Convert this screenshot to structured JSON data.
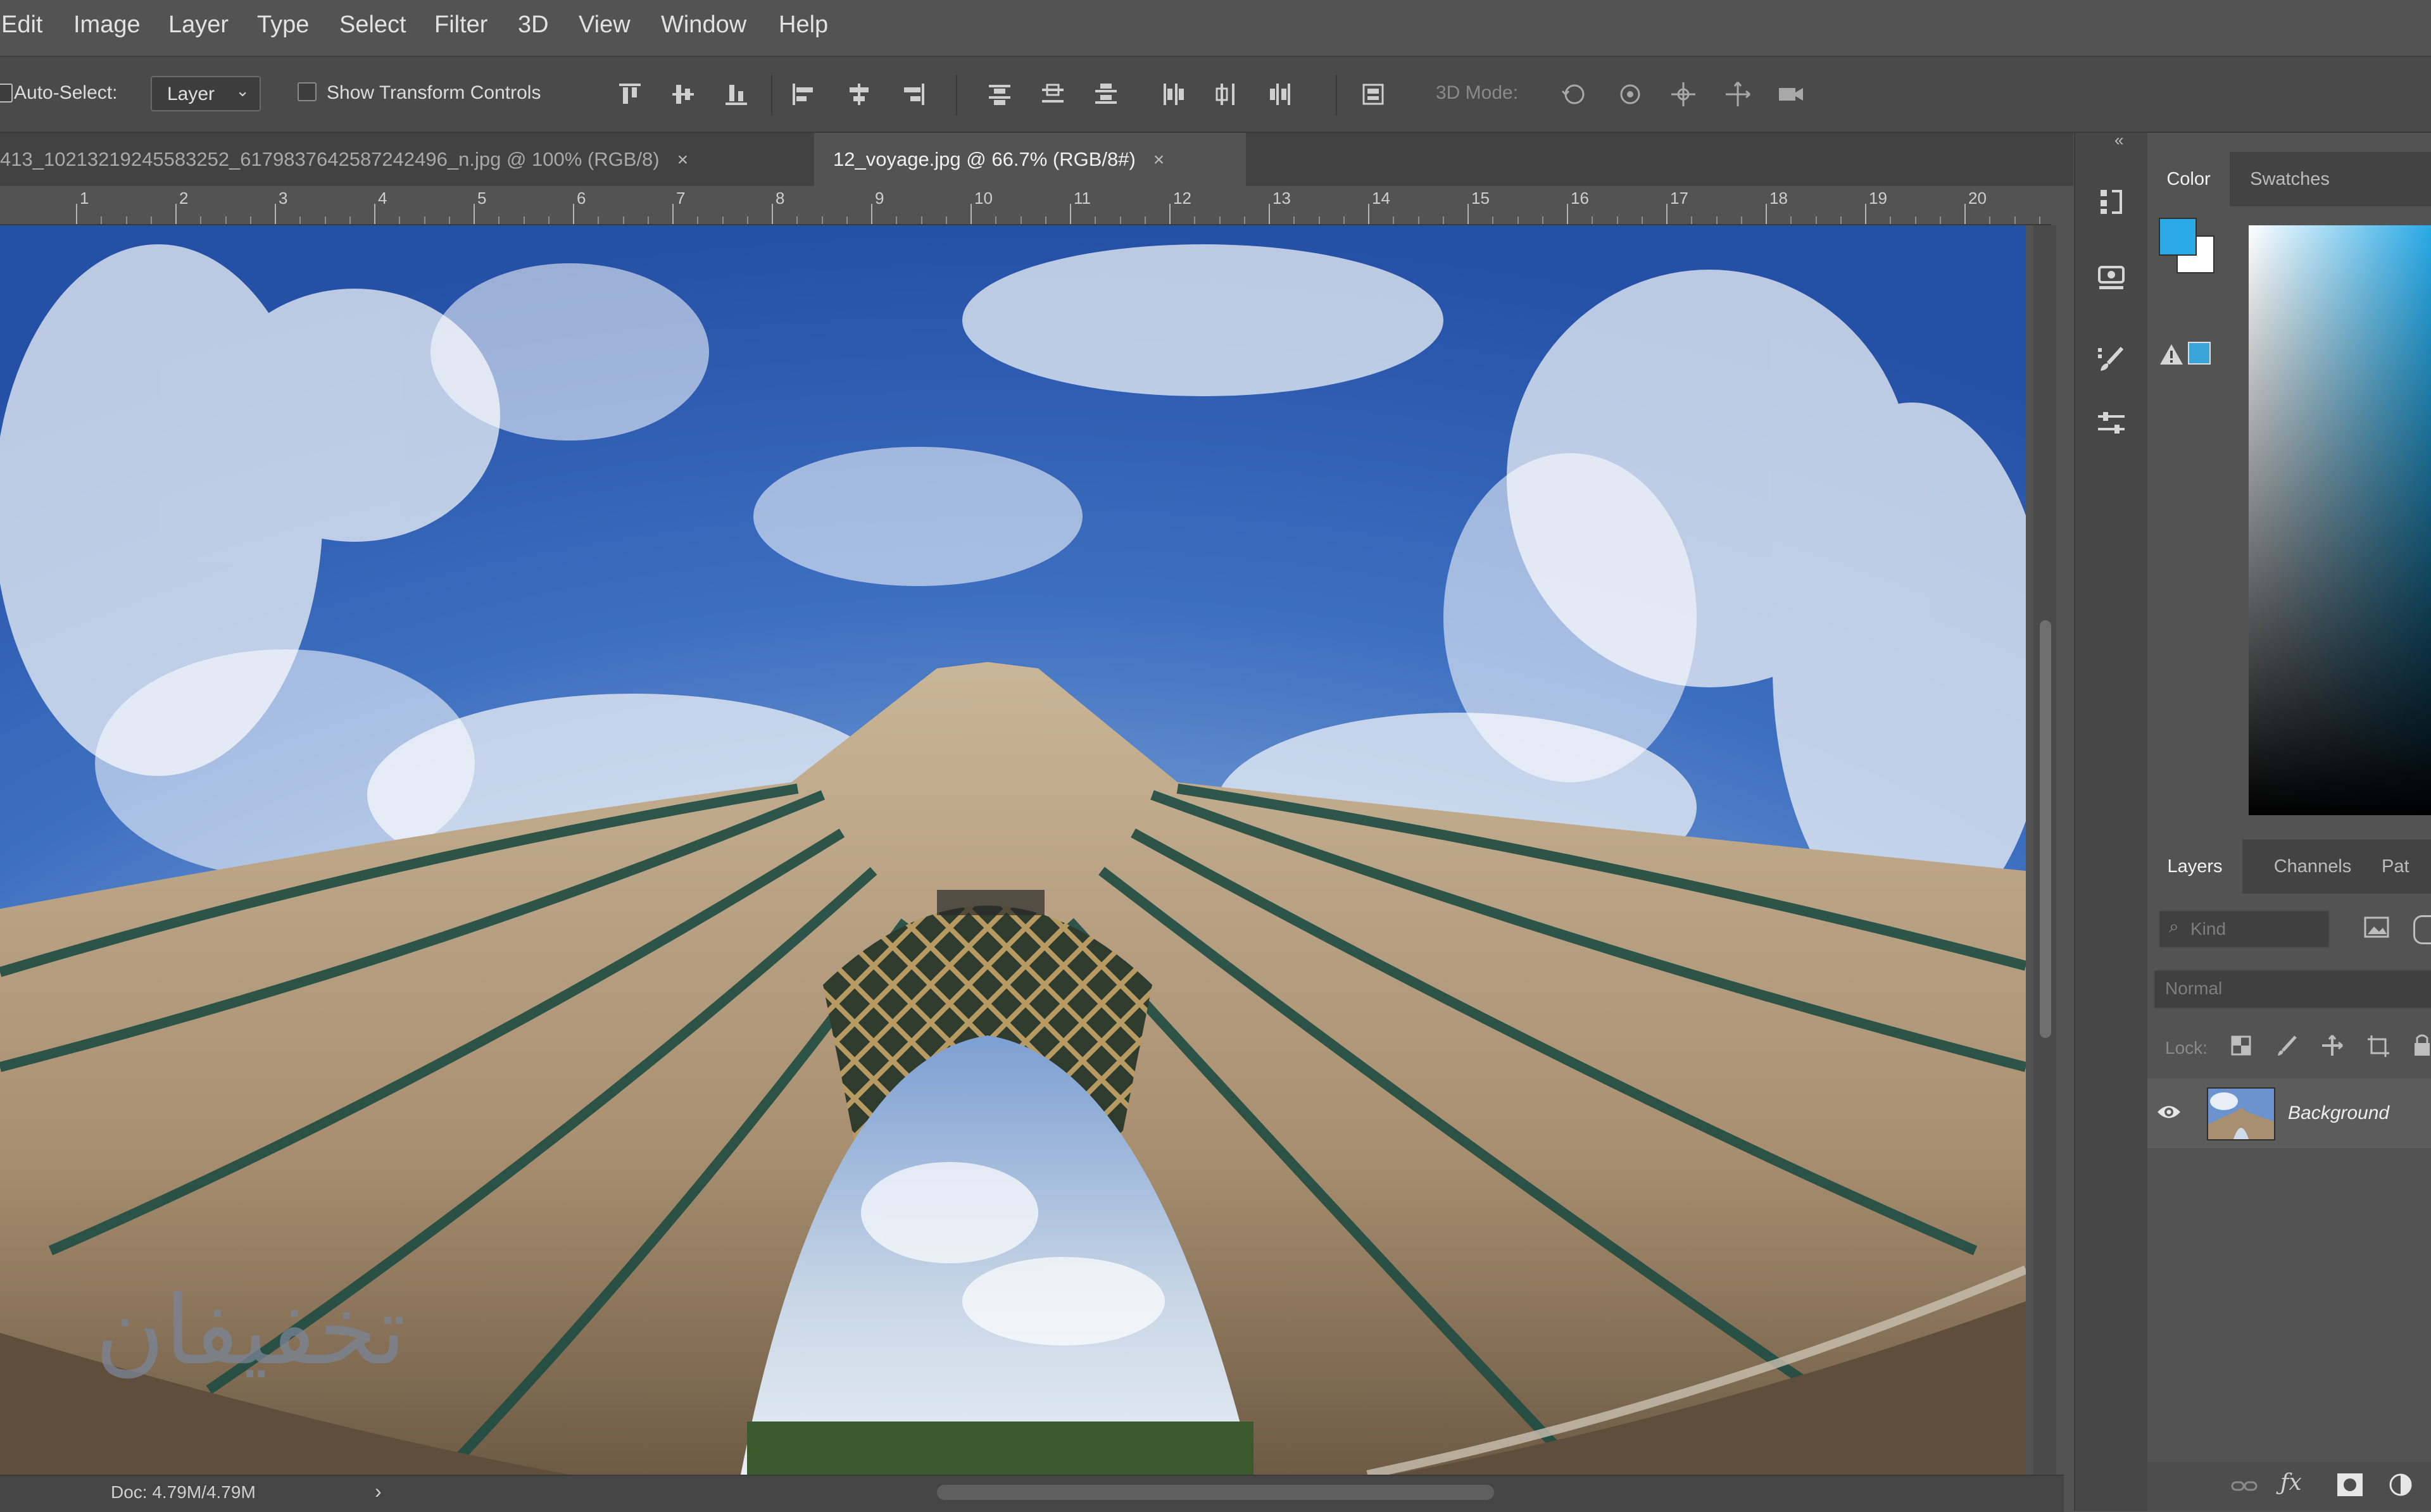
{
  "menu": {
    "items": [
      "Edit",
      "Image",
      "Layer",
      "Type",
      "Select",
      "Filter",
      "3D",
      "View",
      "Window",
      "Help"
    ]
  },
  "options": {
    "auto_select_label": "Auto-Select:",
    "auto_select_value": "Layer",
    "show_transform_label": "Show Transform Controls",
    "mode_3d_label": "3D Mode:"
  },
  "tabs": [
    {
      "label": "413_10213219245583252_6179837642587242496_n.jpg @ 100% (RGB/8)",
      "close": "×",
      "active": false
    },
    {
      "label": "12_voyage.jpg @ 66.7% (RGB/8#)",
      "close": "×",
      "active": true
    }
  ],
  "ruler": {
    "marks": [
      "1",
      "2",
      "3",
      "4",
      "5",
      "6",
      "7",
      "8",
      "9",
      "10",
      "11",
      "12",
      "13",
      "14",
      "15",
      "16",
      "17",
      "18",
      "19",
      "20"
    ]
  },
  "status": {
    "doc": "Doc: 4.79M/4.79M",
    "arrow": "›"
  },
  "watermark": "تخفیفان",
  "color_panel": {
    "tabs": [
      "Color",
      "Swatches"
    ],
    "foreground": "#29a9e6",
    "background": "#ffffff",
    "gamut_swatch": "#3aa5d8"
  },
  "layers_panel": {
    "tabs": [
      "Layers",
      "Channels",
      "Pat"
    ],
    "search_placeholder": "Kind",
    "blend_mode": "Normal",
    "lock_label": "Lock:",
    "layers": [
      {
        "name": "Background",
        "visible": true
      }
    ]
  },
  "colors": {
    "accent": "#29a9e6",
    "ui_bg": "#535353"
  }
}
